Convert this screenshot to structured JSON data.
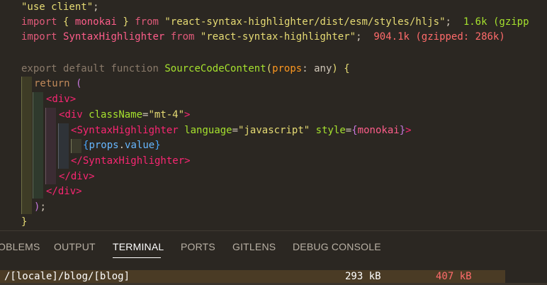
{
  "code": {
    "line1": {
      "str": "\"use client\"",
      "semi": ";"
    },
    "line2": {
      "kw_import": "import",
      "brace_open": "{",
      "ident": "monokai",
      "brace_close": "}",
      "kw_from": "from",
      "str": "\"react-syntax-highlighter/dist/esm/styles/hljs\"",
      "semi": ";",
      "size": "1.6k (gzipp"
    },
    "line3": {
      "kw_import": "import",
      "ident": "SyntaxHighlighter",
      "kw_from": "from",
      "str": "\"react-syntax-highlighter\"",
      "semi": ";",
      "size": "904.1k (gzipped: 286k)"
    },
    "line5": {
      "kw_export": "export",
      "kw_default": "default",
      "kw_function": "function",
      "fn": "SourceCodeContent",
      "paren_open": "(",
      "param": "props",
      "colon": ":",
      "type": "any",
      "paren_close": ")",
      "brace": "{"
    },
    "line6": {
      "kw_return": "return",
      "paren": "("
    },
    "line7": {
      "tag": "<div>"
    },
    "line8": {
      "lt": "<",
      "tag": "div",
      "attr": "className",
      "eq": "=",
      "str": "\"mt-4\"",
      "gt": ">"
    },
    "line9": {
      "lt": "<",
      "tag": "SyntaxHighlighter",
      "attr1": "language",
      "eq1": "=",
      "str1": "\"javascript\"",
      "attr2": "style",
      "eq2": "=",
      "brace_open": "{",
      "val": "monokai",
      "brace_close": "}",
      "gt": ">"
    },
    "line10": {
      "brace_open": "{",
      "obj": "props",
      "dot": ".",
      "prop": "value",
      "brace_close": "}"
    },
    "line11": {
      "tag": "</SyntaxHighlighter>"
    },
    "line12": {
      "tag": "</div>"
    },
    "line13": {
      "tag": "</div>"
    },
    "line14": {
      "paren": ")",
      "semi": ";"
    },
    "line15": {
      "brace": "}"
    }
  },
  "panel": {
    "tabs": [
      {
        "label": "OBLEMS"
      },
      {
        "label": "OUTPUT"
      },
      {
        "label": "TERMINAL"
      },
      {
        "label": "PORTS"
      },
      {
        "label": "GITLENS"
      },
      {
        "label": "DEBUG CONSOLE"
      }
    ],
    "active_tab": "TERMINAL"
  },
  "terminal": {
    "rows": [
      {
        "route": "/[locale]/blog/[blog]",
        "size": "293 kB",
        "first_load": "407 kB"
      }
    ]
  },
  "colors": {
    "background": "#2b2722",
    "tab_active": "#ffffff",
    "first_load_red": "#ff6b6b"
  }
}
